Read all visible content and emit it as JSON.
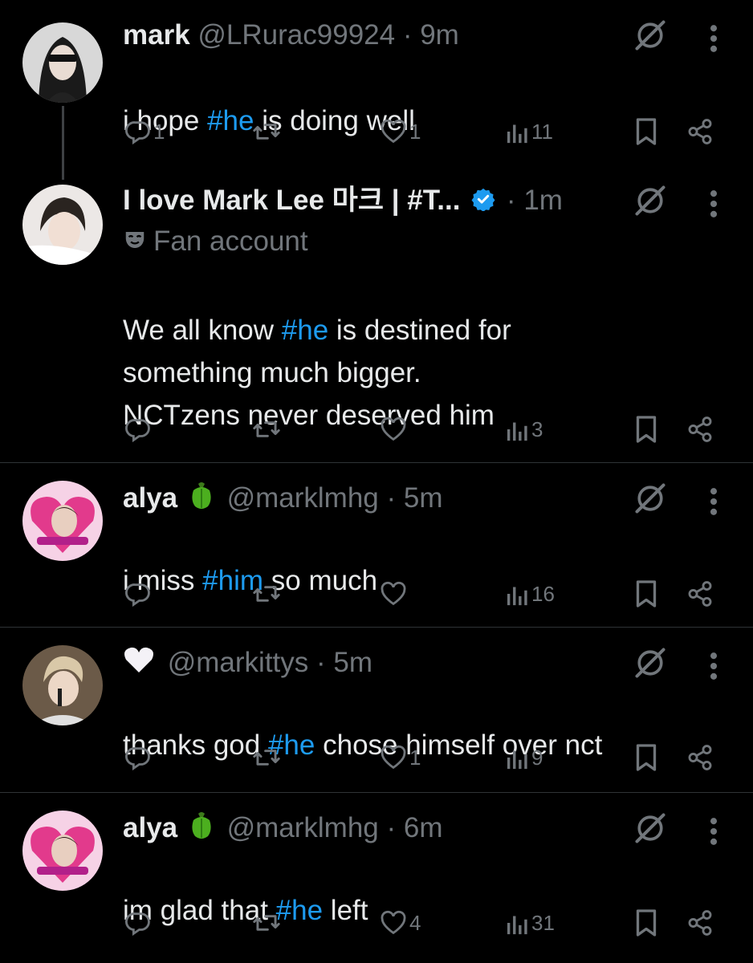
{
  "tweets": [
    {
      "name": "mark",
      "handle": "@LRurac99924",
      "time": "9m",
      "text_parts": [
        "i hope ",
        "#he",
        " is doing well"
      ],
      "replies": "1",
      "likes": "1",
      "views": "11"
    },
    {
      "name": "I love Mark Lee 마크 | #T...",
      "verified": true,
      "time": "1m",
      "label": "Fan account",
      "text_parts": [
        "We all know ",
        "#he",
        " is destined for\nsomething much bigger.\nNCTzens never deserved him"
      ],
      "replies": "",
      "likes": "",
      "views": "3"
    },
    {
      "name": "alya",
      "emoji": "pepper",
      "handle": "@marklmhg",
      "time": "5m",
      "text_parts": [
        "i miss ",
        "#him",
        " so much"
      ],
      "replies": "",
      "likes": "",
      "views": "16"
    },
    {
      "emoji": "white-heart",
      "handle": "@markittys",
      "time": "5m",
      "text_parts": [
        "thanks god ",
        "#he",
        " chose himself over nct"
      ],
      "replies": "",
      "likes": "1",
      "views": "9"
    },
    {
      "name": "alya",
      "emoji": "pepper",
      "handle": "@marklmhg",
      "time": "6m",
      "text_parts": [
        "im glad that ",
        "#he",
        " left"
      ],
      "replies": "",
      "likes": "4",
      "views": "31"
    }
  ],
  "separator": "·",
  "colors": {
    "background": "#000000",
    "text": "#e7e9ea",
    "muted": "#71767b",
    "link": "#1d9bf0",
    "verified": "#1d9bf0",
    "divider": "#2f3336"
  },
  "icons": [
    "reply-icon",
    "retweet-icon",
    "like-icon",
    "views-icon",
    "bookmark-icon",
    "share-icon",
    "mute-icon",
    "more-icon",
    "verified-icon",
    "mask-icon"
  ]
}
